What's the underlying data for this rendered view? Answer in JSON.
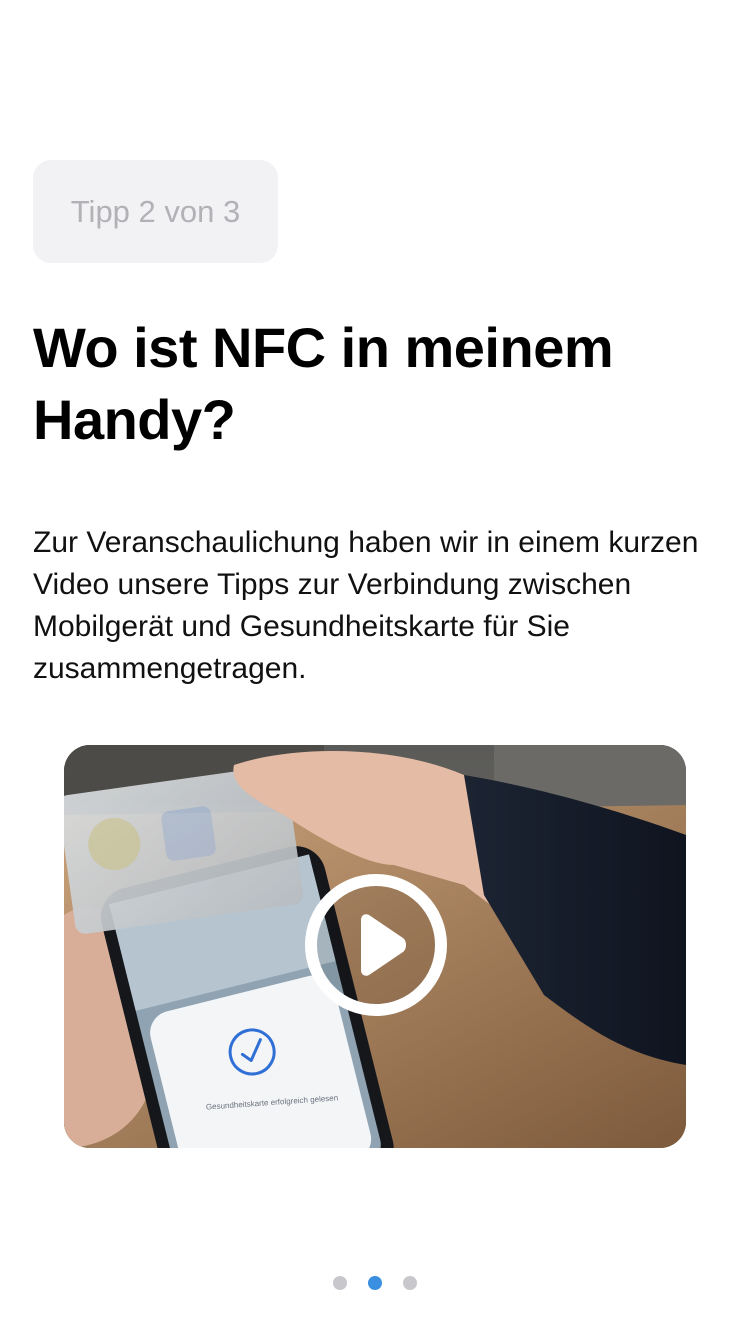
{
  "tip": {
    "label": "Tipp 2 von 3"
  },
  "title": "Wo ist NFC in meinem Handy?",
  "description": "Zur Veranschaulichung haben wir in einem kurzen Video unsere Tipps zur Verbindung zwischen Mobilgerät und Gesundheitskarte für Sie zusammengetragen.",
  "video": {
    "device_caption": "Gesundheitskarte erfolgreich gelesen",
    "play_icon": "play-icon",
    "check_icon": "checkmark-circle-icon"
  },
  "pager": {
    "total": 3,
    "current": 2,
    "active_color": "#3a8fe0",
    "inactive_color": "#c7c7cc"
  }
}
